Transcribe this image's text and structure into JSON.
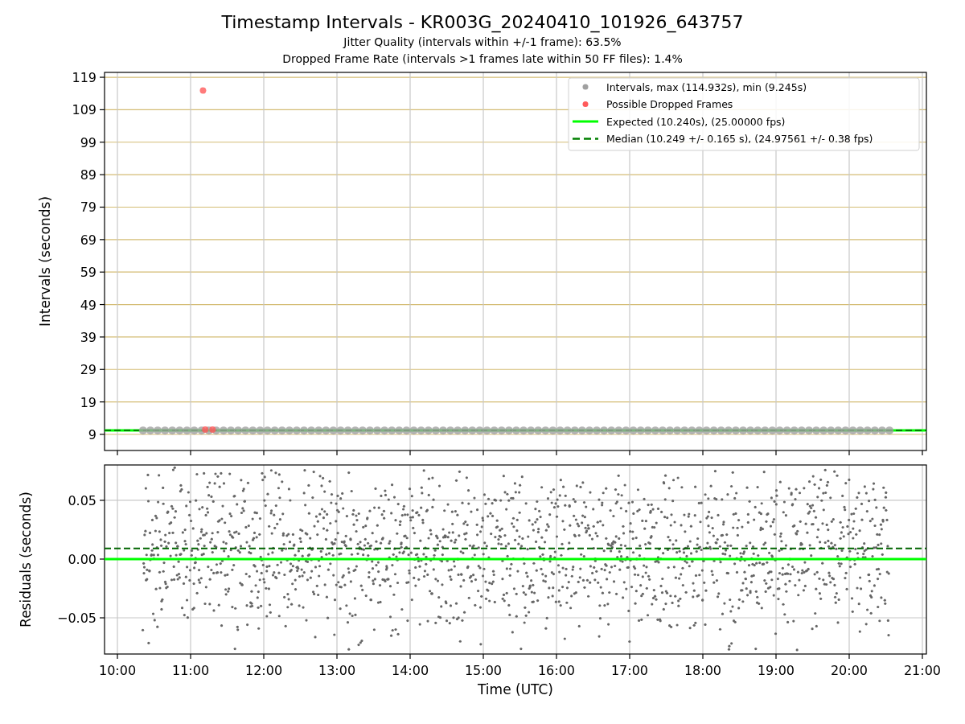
{
  "figure": {
    "title": "Timestamp Intervals - KR003G_20240410_101926_643757",
    "subtitles": [
      "Jitter Quality (intervals within +/-1 frame): 63.5%",
      "Dropped Frame Rate (intervals >1 frames late within 50 FF files): 1.4%"
    ]
  },
  "panels": [
    {
      "chart_data": {
        "type": "scatter",
        "ylabel": "Intervals (seconds)",
        "grid": true,
        "legend": "upper right",
        "xlim": [
          9.824,
          21.055
        ],
        "ylim": [
          4.04,
          120.5
        ],
        "yticks": [
          {
            "value": 9,
            "label": "9"
          },
          {
            "value": 19,
            "label": "19"
          },
          {
            "value": 29,
            "label": "29"
          },
          {
            "value": 39,
            "label": "39"
          },
          {
            "value": 49,
            "label": "49"
          },
          {
            "value": 59,
            "label": "59"
          },
          {
            "value": 69,
            "label": "69"
          },
          {
            "value": 79,
            "label": "79"
          },
          {
            "value": 89,
            "label": "89"
          },
          {
            "value": 99,
            "label": "99"
          },
          {
            "value": 109,
            "label": "109"
          },
          {
            "value": 119,
            "label": "119"
          }
        ],
        "series": [
          {
            "name": "Intervals, max (114.932s), min (9.245s)",
            "color": "#a0a0a0",
            "x": [
              10.35,
              10.45,
              10.55,
              10.65,
              10.75,
              10.85,
              10.95,
              11.05,
              11.15,
              11.25,
              11.35,
              11.45,
              11.55,
              11.65,
              11.75,
              11.85,
              11.95,
              12.05,
              12.15,
              12.25,
              12.35,
              12.45,
              12.55,
              12.65,
              12.75,
              12.85,
              12.95,
              13.05,
              13.15,
              13.25,
              13.35,
              13.45,
              13.55,
              13.65,
              13.75,
              13.85,
              13.95,
              14.05,
              14.15,
              14.25,
              14.35,
              14.45,
              14.55,
              14.65,
              14.75,
              14.85,
              14.95,
              15.05,
              15.15,
              15.25,
              15.35,
              15.45,
              15.55,
              15.65,
              15.75,
              15.85,
              15.95,
              16.05,
              16.15,
              16.25,
              16.35,
              16.45,
              16.55,
              16.65,
              16.75,
              16.85,
              16.95,
              17.05,
              17.15,
              17.25,
              17.35,
              17.45,
              17.55,
              17.65,
              17.75,
              17.85,
              17.95,
              18.05,
              18.15,
              18.25,
              18.35,
              18.45,
              18.55,
              18.65,
              18.75,
              18.85,
              18.95,
              19.05,
              19.15,
              19.25,
              19.35,
              19.45,
              19.55,
              19.65,
              19.75,
              19.85,
              19.95,
              20.05,
              20.15,
              20.25,
              20.35,
              20.45,
              20.55
            ],
            "values": [
              10.2,
              10.2,
              10.2,
              10.2,
              10.2,
              10.2,
              10.2,
              10.2,
              10.2,
              10.2,
              10.2,
              10.2,
              10.2,
              10.2,
              10.2,
              10.2,
              10.2,
              10.2,
              10.2,
              10.2,
              10.2,
              10.2,
              10.2,
              10.2,
              10.2,
              10.2,
              10.2,
              10.2,
              10.2,
              10.2,
              10.2,
              10.2,
              10.2,
              10.2,
              10.2,
              10.2,
              10.2,
              10.2,
              10.2,
              10.2,
              10.2,
              10.2,
              10.2,
              10.2,
              10.2,
              10.2,
              10.2,
              10.2,
              10.2,
              10.2,
              10.2,
              10.2,
              10.2,
              10.2,
              10.2,
              10.2,
              10.2,
              10.2,
              10.2,
              10.2,
              10.2,
              10.2,
              10.2,
              10.2,
              10.2,
              10.2,
              10.2,
              10.2,
              10.2,
              10.2,
              10.2,
              10.2,
              10.2,
              10.2,
              10.2,
              10.2,
              10.2,
              10.2,
              10.2,
              10.2,
              10.2,
              10.2,
              10.2,
              10.2,
              10.2,
              10.2,
              10.2,
              10.2,
              10.2,
              10.2,
              10.2,
              10.2,
              10.2,
              10.2,
              10.2,
              10.2,
              10.2,
              10.2,
              10.2,
              10.2,
              10.2,
              10.2,
              10.2
            ]
          },
          {
            "name": "Possible Dropped Frames",
            "color": "#ff5a5a",
            "x": [
              11.17,
              11.2,
              11.3
            ],
            "values": [
              114.9,
              10.5,
              10.5
            ]
          },
          {
            "name": "Expected (10.240s), (25.00000 fps)",
            "type": "line",
            "color": "#00ff00",
            "x": [
              9.824,
              21.055
            ],
            "values": [
              10.24,
              10.24
            ]
          },
          {
            "name": "Median (10.249 +/- 0.165 s), (24.97561 +/- 0.38 fps)",
            "type": "line",
            "line_style": "dashed",
            "color": "#008000",
            "x": [
              9.824,
              21.055
            ],
            "values": [
              10.249,
              10.249
            ]
          }
        ]
      }
    },
    {
      "point_cloud": {
        "color": "#666666"
      },
      "chart_data": {
        "type": "scatter",
        "ylabel": "Residuals (seconds)",
        "xlabel": "Time (UTC)",
        "grid": true,
        "xlim": [
          9.824,
          21.055
        ],
        "ylim": [
          -0.0808,
          0.0801
        ],
        "xticks": [
          {
            "value": 10,
            "label": "10:00"
          },
          {
            "value": 11,
            "label": "11:00"
          },
          {
            "value": 12,
            "label": "12:00"
          },
          {
            "value": 13,
            "label": "13:00"
          },
          {
            "value": 14,
            "label": "14:00"
          },
          {
            "value": 15,
            "label": "15:00"
          },
          {
            "value": 16,
            "label": "16:00"
          },
          {
            "value": 17,
            "label": "17:00"
          },
          {
            "value": 18,
            "label": "18:00"
          },
          {
            "value": 19,
            "label": "19:00"
          },
          {
            "value": 20,
            "label": "20:00"
          },
          {
            "value": 21,
            "label": "21:00"
          }
        ],
        "yticks": [
          {
            "value": 0.05,
            "label": "0.05"
          },
          {
            "value": 0,
            "label": "0.00"
          },
          {
            "value": -0.05,
            "label": "−0.05"
          }
        ],
        "series": [
          {
            "type": "line",
            "color": "#00ff00",
            "x": [
              9.824,
              21.055
            ],
            "values": [
              0,
              0
            ]
          },
          {
            "type": "line",
            "line_style": "dashed",
            "color": "#006400",
            "x": [
              9.824,
              21.055
            ],
            "values": [
              0.009,
              0.009
            ]
          }
        ]
      }
    }
  ]
}
